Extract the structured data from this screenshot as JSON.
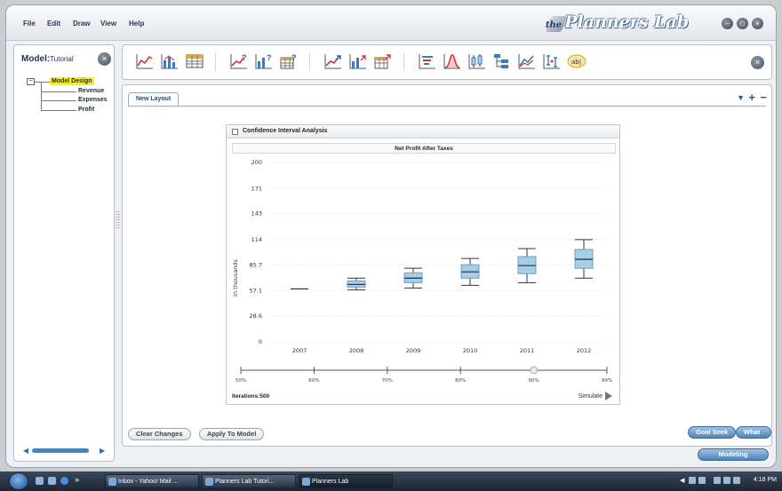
{
  "menu": {
    "items": [
      "File",
      "Edit",
      "Draw",
      "View",
      "Help"
    ]
  },
  "brand": {
    "prefix": "the",
    "name": "Planners Lab"
  },
  "left_panel": {
    "title": "Model:",
    "model_name": "Tutorial",
    "tree": {
      "root": "Model Design",
      "children": [
        "Revenue",
        "Expenses",
        "Profit"
      ],
      "collapse_symbol": "−"
    }
  },
  "toolbar": {
    "icons": [
      "line-chart-icon",
      "bar-chart-icon",
      "table-icon",
      "line-whatif-icon",
      "bar-whatif-icon",
      "table-whatif-icon",
      "line-goalseek-icon",
      "bar-goalseek-icon",
      "table-goalseek-icon",
      "tornado-icon",
      "distribution-icon",
      "confidence-icon",
      "tree-icon",
      "scenario-icon",
      "interval-icon",
      "label-icon"
    ],
    "label_icon_text": "ab|"
  },
  "tabs": {
    "active": "New Layout"
  },
  "widget": {
    "title": "Confidence Interval Analysis",
    "chart_title": "Net Profit After Taxes",
    "iterations_label": "Iterations:",
    "iterations_value": "500",
    "simulate_label": "Simulate"
  },
  "chart_data": {
    "type": "boxplot",
    "title": "Net Profit After Taxes",
    "ylabel": "In thousands",
    "ylim": [
      0,
      200
    ],
    "yticks": [
      "0",
      "28.6",
      "57.1",
      "85.7",
      "114",
      "143",
      "171",
      "200"
    ],
    "ytick_values": [
      0,
      28.6,
      57.1,
      85.7,
      114,
      143,
      171,
      200
    ],
    "categories": [
      "2007",
      "2008",
      "2009",
      "2010",
      "2011",
      "2012"
    ],
    "boxes": [
      {
        "x": "2007",
        "whisker_low": 59,
        "q1": 59,
        "median": 59,
        "q3": 59,
        "whisker_high": 59
      },
      {
        "x": "2008",
        "whisker_low": 58,
        "q1": 61,
        "median": 64,
        "q3": 68,
        "whisker_high": 71
      },
      {
        "x": "2009",
        "whisker_low": 60,
        "q1": 66,
        "median": 71,
        "q3": 77,
        "whisker_high": 82
      },
      {
        "x": "2010",
        "whisker_low": 63,
        "q1": 71,
        "median": 78,
        "q3": 86,
        "whisker_high": 93
      },
      {
        "x": "2011",
        "whisker_low": 66,
        "q1": 76,
        "median": 85,
        "q3": 95,
        "whisker_high": 104
      },
      {
        "x": "2012",
        "whisker_low": 71,
        "q1": 82,
        "median": 92,
        "q3": 103,
        "whisker_high": 114
      }
    ],
    "confidence_slider": {
      "ticks": [
        "50%",
        "60%",
        "70%",
        "80%",
        "90%",
        "99%"
      ],
      "value_percent": 90
    },
    "colors": {
      "box_fill": "#a8cde6",
      "box_stroke": "#6f9fc3",
      "median": "#2d3e50",
      "whisker": "#333333"
    }
  },
  "buttons": {
    "clear_changes": "Clear Changes",
    "apply_to_model": "Apply To Model",
    "goal_seek": "Goal Seek",
    "what_if": "What If",
    "modeling": "Modeling"
  },
  "taskbar": {
    "tasks": [
      "Inbox - Yahoo! Mail ...",
      "Planners Lab Tutori...",
      "Planners Lab"
    ],
    "overflow_symbol": "»",
    "clock": "4:18 PM"
  }
}
